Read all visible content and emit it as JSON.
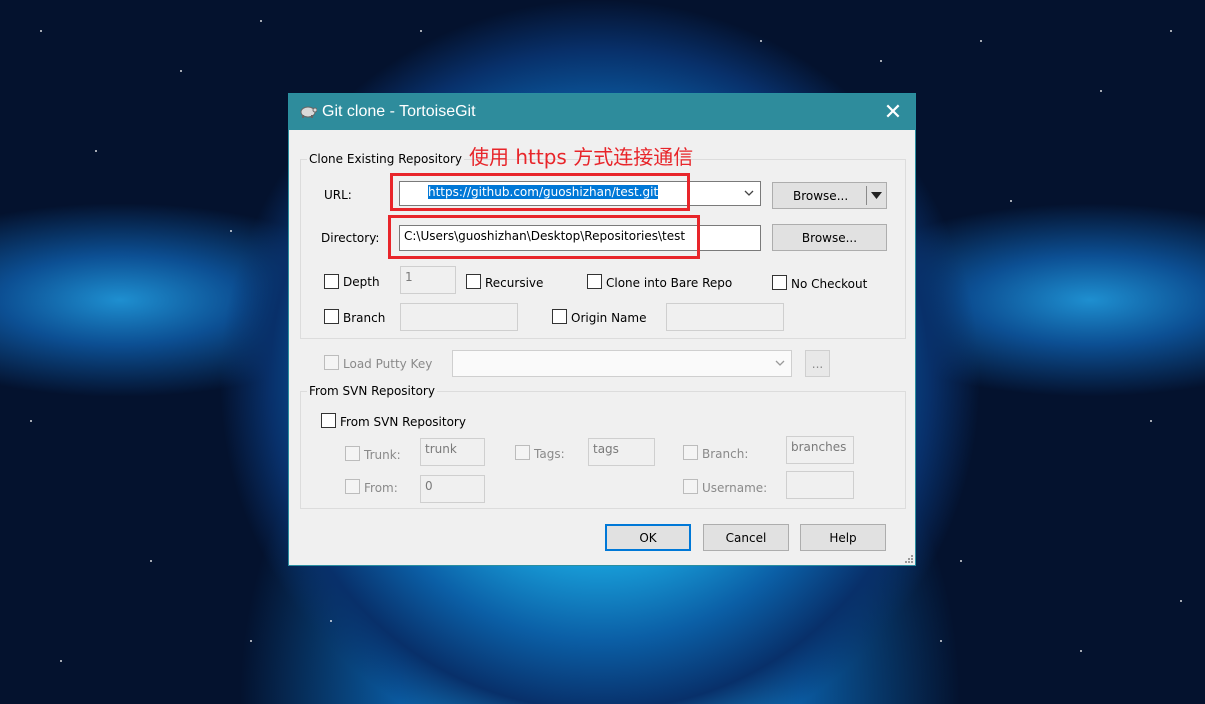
{
  "window": {
    "title": "Git clone - TortoiseGit",
    "close_glyph": "✕"
  },
  "annotation": "使用 https 方式连接通信",
  "clone_group": {
    "label": "Clone Existing Repository",
    "url_label": "URL:",
    "url_value": "https://github.com/guoshizhan/test.git",
    "url_browse": "Browse...",
    "dir_label": "Directory:",
    "dir_value": "C:\\Users\\guoshizhan\\Desktop\\Repositories\\test",
    "dir_browse": "Browse...",
    "depth_label": "Depth",
    "depth_value": "1",
    "recursive_label": "Recursive",
    "bare_label": "Clone into Bare Repo",
    "nocheckout_label": "No Checkout",
    "branch_label": "Branch",
    "origin_label": "Origin Name"
  },
  "putty": {
    "label": "Load Putty Key",
    "browse": "..."
  },
  "svn_group": {
    "label": "From SVN Repository",
    "checkbox_label": "From SVN Repository",
    "trunk_label": "Trunk:",
    "trunk_value": "trunk",
    "tags_label": "Tags:",
    "tags_value": "tags",
    "branch_label": "Branch:",
    "branch_value": "branches",
    "from_label": "From:",
    "from_value": "0",
    "username_label": "Username:"
  },
  "buttons": {
    "ok": "OK",
    "cancel": "Cancel",
    "help": "Help"
  },
  "colors": {
    "titlebar": "#2e8c9c",
    "annotation": "#e8252a",
    "accent": "#0078d7"
  }
}
